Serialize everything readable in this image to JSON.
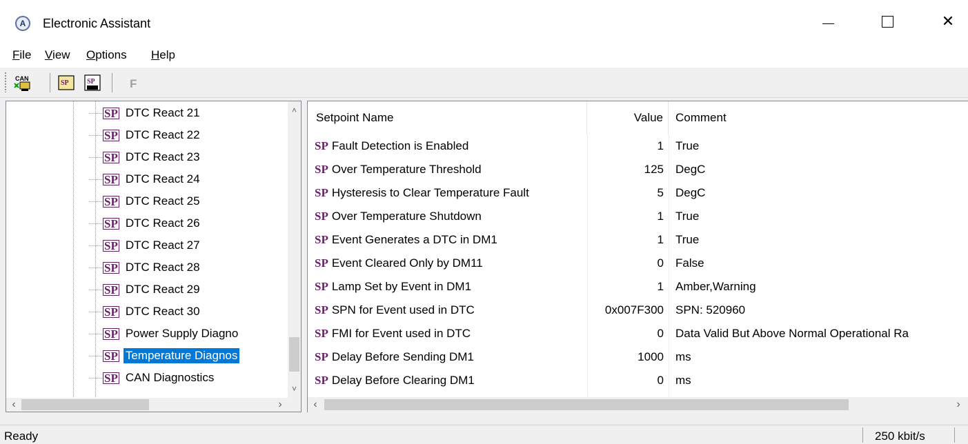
{
  "window": {
    "title": "Electronic Assistant",
    "icon": "app-logo-icon",
    "controls": [
      "minimize",
      "maximize",
      "close"
    ],
    "close_glyph": "✕"
  },
  "menu": {
    "file": "File",
    "view": "View",
    "options": "Options",
    "help": "Help"
  },
  "toolbar": {
    "can_label": "CAN",
    "sp_label": "SP",
    "f_label": "F"
  },
  "tree": {
    "icon_label": "SP",
    "items": [
      {
        "label": "DTC React 21",
        "selected": false
      },
      {
        "label": "DTC React 22",
        "selected": false
      },
      {
        "label": "DTC React 23",
        "selected": false
      },
      {
        "label": "DTC React 24",
        "selected": false
      },
      {
        "label": "DTC React 25",
        "selected": false
      },
      {
        "label": "DTC React 26",
        "selected": false
      },
      {
        "label": "DTC React 27",
        "selected": false
      },
      {
        "label": "DTC React 28",
        "selected": false
      },
      {
        "label": "DTC React 29",
        "selected": false
      },
      {
        "label": "DTC React 30",
        "selected": false
      },
      {
        "label": "Power Supply Diagno",
        "selected": false
      },
      {
        "label": "Temperature Diagnos",
        "selected": true
      },
      {
        "label": "CAN Diagnostics",
        "selected": false
      }
    ]
  },
  "table": {
    "columns": {
      "name": "Setpoint Name",
      "value": "Value",
      "comment": "Comment"
    },
    "sp_label": "SP",
    "rows": [
      {
        "name": "Fault Detection is Enabled",
        "value": "1",
        "comment": "True"
      },
      {
        "name": "Over Temperature Threshold",
        "value": "125",
        "comment": "DegC"
      },
      {
        "name": "Hysteresis to Clear Temperature Fault",
        "value": "5",
        "comment": "DegC"
      },
      {
        "name": "Over Temperature Shutdown",
        "value": "1",
        "comment": "True"
      },
      {
        "name": "Event Generates a DTC in DM1",
        "value": "1",
        "comment": "True"
      },
      {
        "name": "Event Cleared Only by DM11",
        "value": "0",
        "comment": "False"
      },
      {
        "name": "Lamp Set by Event in DM1",
        "value": "1",
        "comment": "Amber,Warning"
      },
      {
        "name": "SPN for Event used in DTC",
        "value": "0x007F300",
        "comment": "SPN: 520960"
      },
      {
        "name": "FMI for Event used in DTC",
        "value": "0",
        "comment": "Data Valid But Above Normal Operational Ra"
      },
      {
        "name": "Delay Before Sending DM1",
        "value": "1000",
        "comment": "ms"
      },
      {
        "name": "Delay Before Clearing DM1",
        "value": "0",
        "comment": "ms"
      }
    ]
  },
  "status": {
    "text": "Ready",
    "baud": "250 kbit/s"
  },
  "colors": {
    "selection": "#0078d7",
    "sp_icon": "#6b1f6b"
  }
}
